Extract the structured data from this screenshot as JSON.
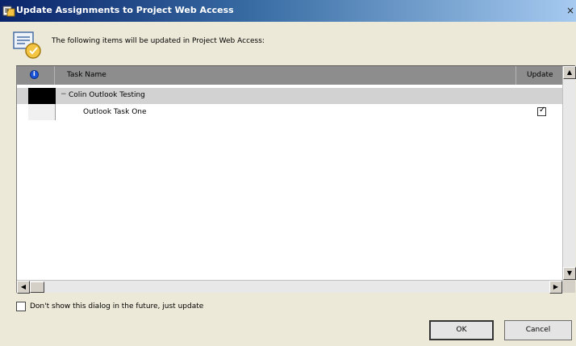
{
  "window": {
    "title": "Update Assignments to Project Web Access",
    "close_glyph": "×"
  },
  "message": {
    "text": "The following items will be updated in Project Web Access:"
  },
  "grid": {
    "headers": {
      "info_glyph": "i",
      "task_name": "Task Name",
      "update": "Update"
    },
    "rows": [
      {
        "type": "group",
        "collapse_glyph": "−",
        "label": "Colin Outlook Testing"
      },
      {
        "type": "task",
        "label": "Outlook Task One",
        "checked": true,
        "check_glyph": "✓"
      }
    ],
    "scroll_glyphs": {
      "up": "▲",
      "down": "▼",
      "left": "◀",
      "right": "▶"
    }
  },
  "footer": {
    "dont_show_label": "Don't show this dialog in the future, just update",
    "ok_label": "OK",
    "cancel_label": "Cancel"
  }
}
